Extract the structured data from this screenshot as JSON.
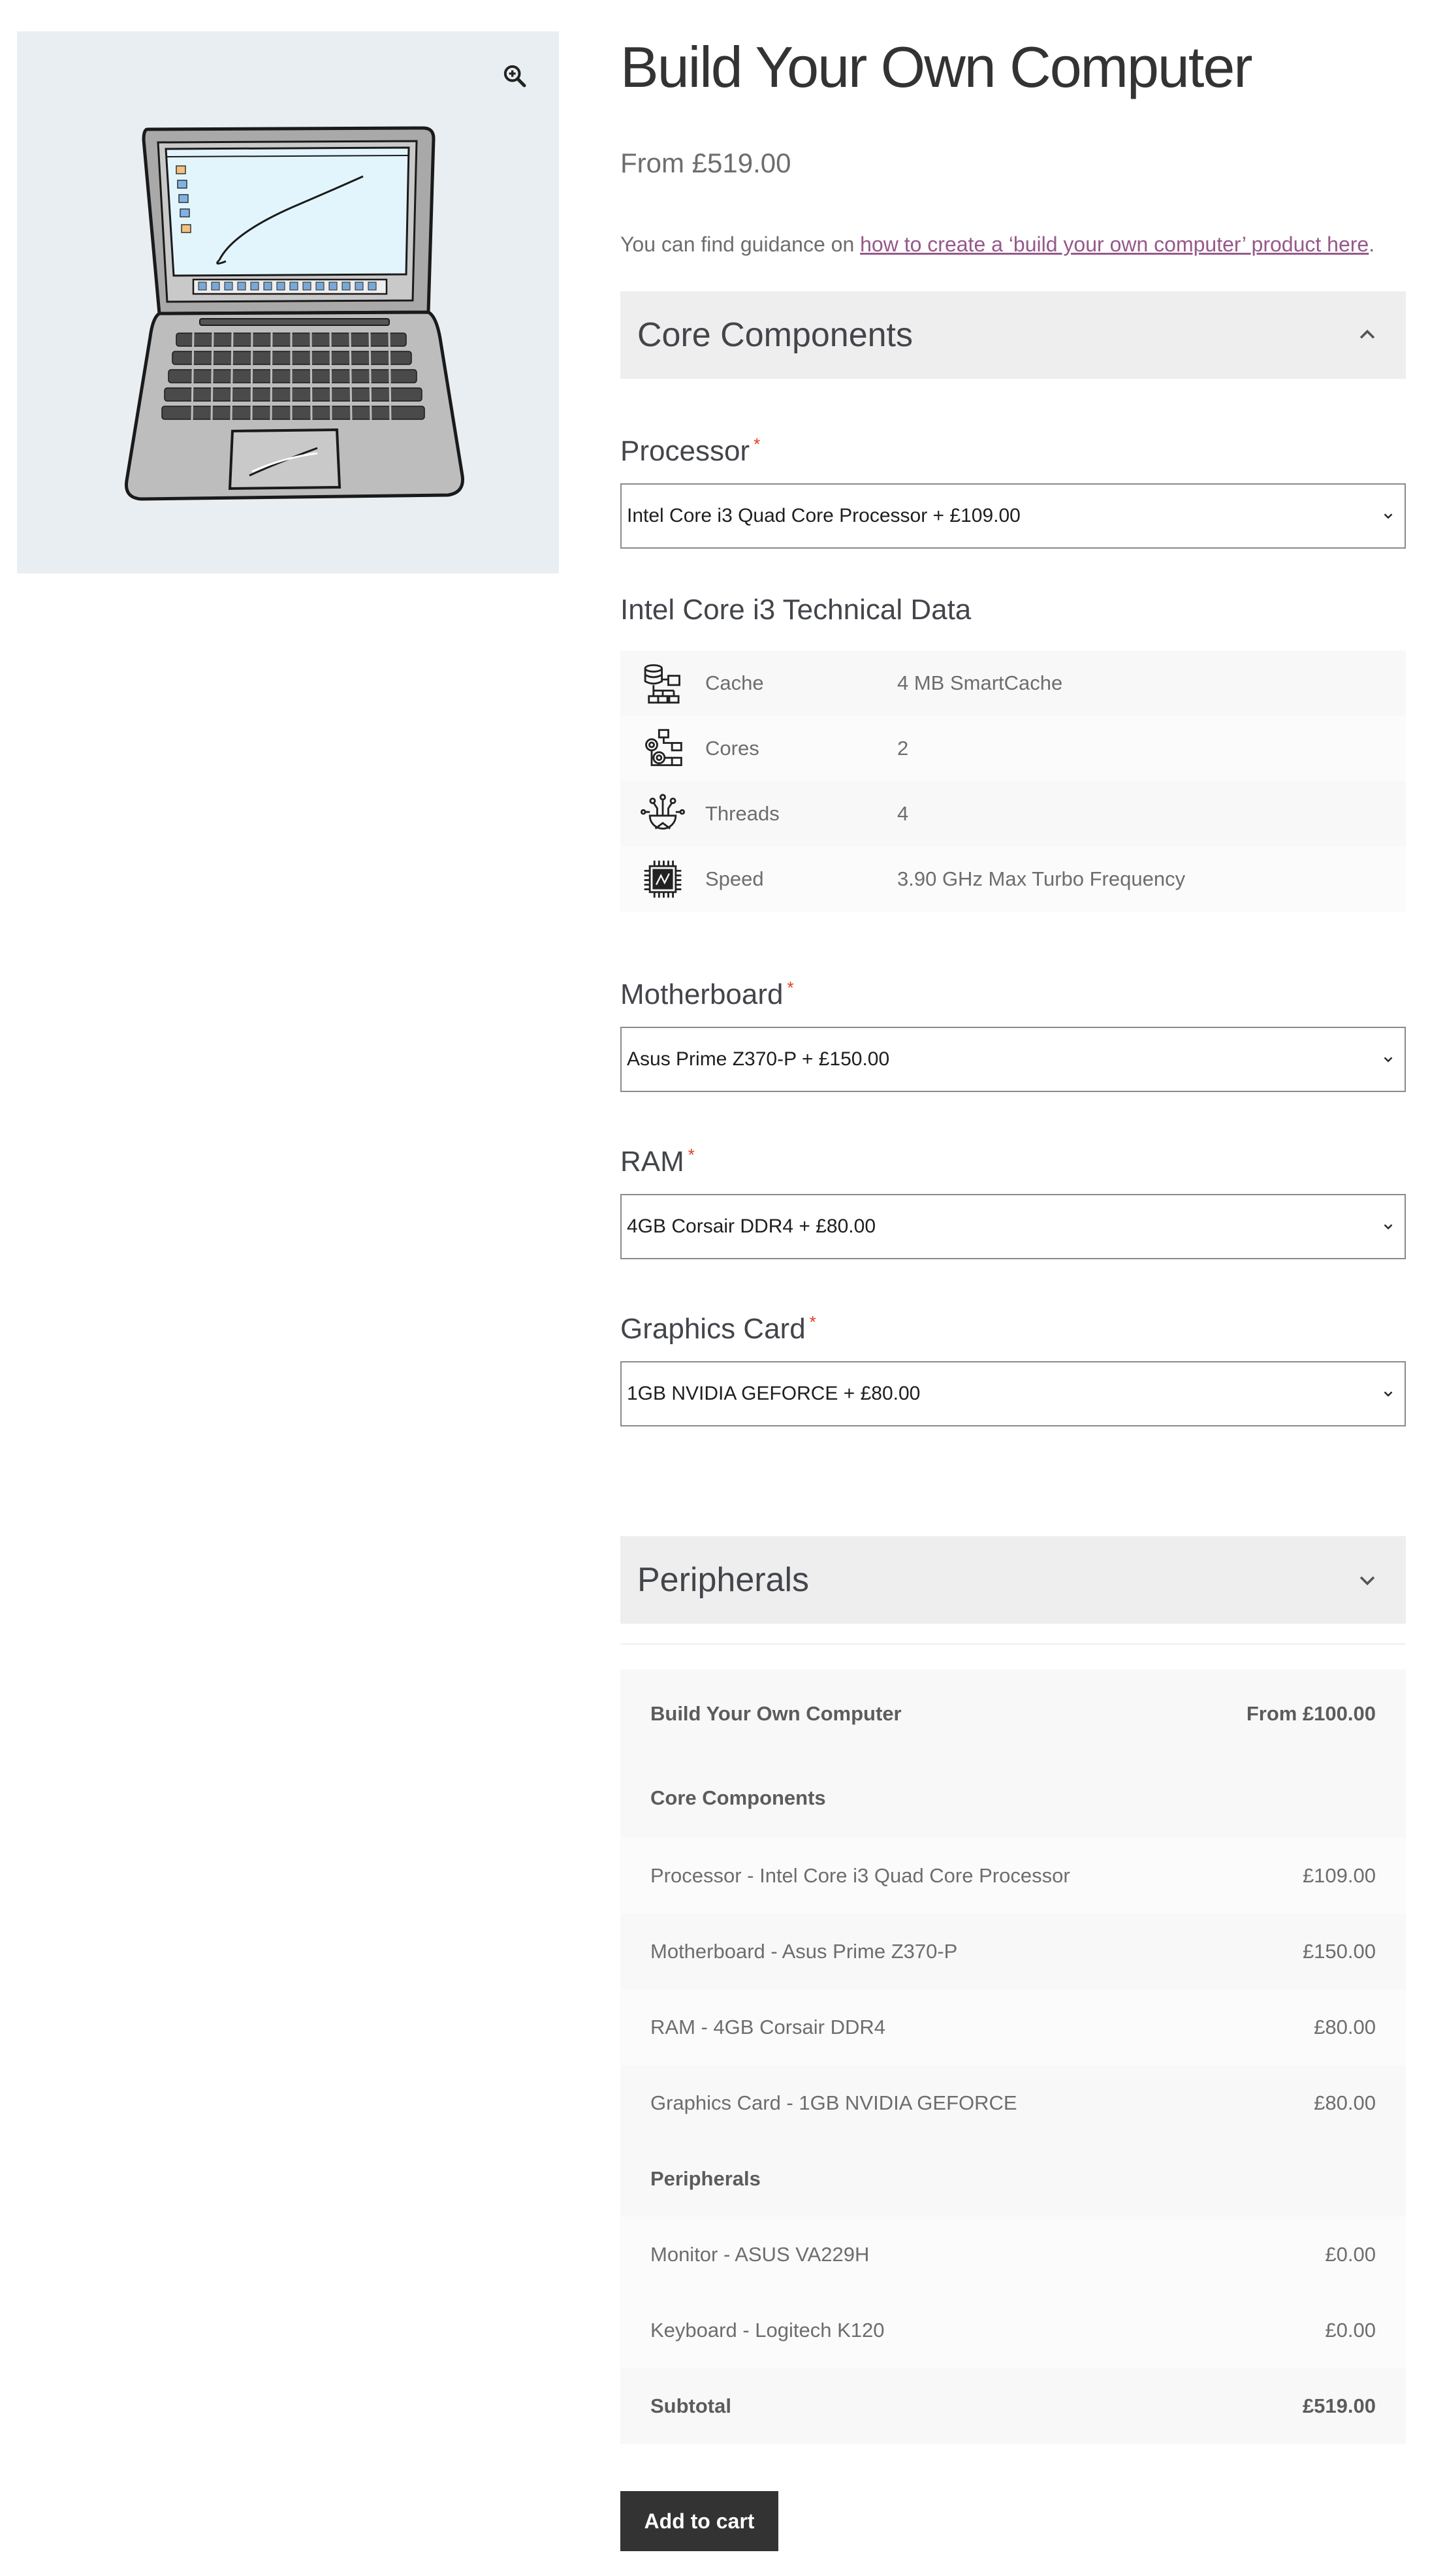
{
  "product": {
    "title": "Build Your Own Computer",
    "price": "From £519.00",
    "guidance_prefix": "You can find guidance on ",
    "guidance_link": "how to create a ‘build your own computer’ product here",
    "guidance_suffix": "."
  },
  "gallery": {
    "zoom_icon": "zoom-in-icon",
    "image": "laptop-illustration"
  },
  "core": {
    "heading": "Core Components",
    "processor": {
      "label": "Processor",
      "required": "*",
      "selected": "Intel Core i3 Quad Core Processor + £109.00"
    },
    "tech": {
      "title": "Intel Core i3 Technical Data",
      "rows": [
        {
          "icon": "cache-icon",
          "key": "Cache",
          "value": "4 MB SmartCache"
        },
        {
          "icon": "cores-icon",
          "key": "Cores",
          "value": "2"
        },
        {
          "icon": "threads-icon",
          "key": "Threads",
          "value": "4"
        },
        {
          "icon": "chip-icon",
          "key": "Speed",
          "value": "3.90 GHz Max Turbo Frequency"
        }
      ]
    },
    "motherboard": {
      "label": "Motherboard",
      "required": "*",
      "selected": "Asus Prime Z370-P + £150.00"
    },
    "ram": {
      "label": "RAM",
      "required": "*",
      "selected": "4GB Corsair DDR4 + £80.00"
    },
    "graphics": {
      "label": "Graphics Card",
      "required": "*",
      "selected": "1GB NVIDIA GEFORCE + £80.00"
    }
  },
  "peripherals": {
    "heading": "Peripherals"
  },
  "totals": {
    "product_name": "Build Your Own Computer",
    "product_price": "From £100.00",
    "core_heading": "Core Components",
    "lines": [
      {
        "label": "Processor - Intel Core i3 Quad Core Processor",
        "price": "£109.00"
      },
      {
        "label": "Motherboard - Asus Prime Z370-P",
        "price": "£150.00"
      },
      {
        "label": "RAM - 4GB Corsair DDR4",
        "price": "£80.00"
      },
      {
        "label": "Graphics Card - 1GB NVIDIA GEFORCE",
        "price": "£80.00"
      }
    ],
    "peripherals_heading": "Peripherals",
    "peripheral_lines": [
      {
        "label": "Monitor - ASUS VA229H",
        "price": "£0.00"
      },
      {
        "label": "Keyboard - Logitech K120",
        "price": "£0.00"
      }
    ],
    "subtotal_label": "Subtotal",
    "subtotal_value": "£519.00"
  },
  "cart": {
    "add_label": "Add to cart"
  },
  "colors": {
    "accent_link": "#96588a",
    "required": "#e2401c",
    "button": "#333333"
  }
}
